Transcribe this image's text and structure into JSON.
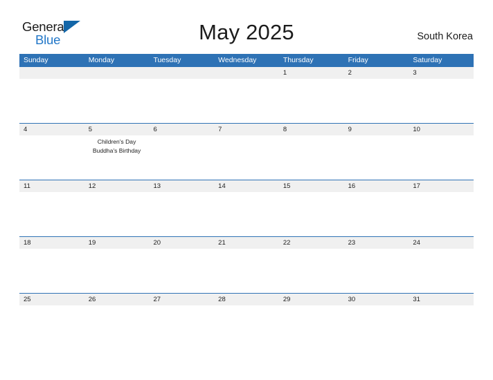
{
  "brand": {
    "name_part1": "General",
    "name_part2": "Blue",
    "colors": {
      "dark": "#1a1a1a",
      "blue": "#2277c8",
      "triangle": "#1366a8"
    }
  },
  "header": {
    "title": "May 2025",
    "country": "South Korea"
  },
  "theme": {
    "header_blue": "#2e72b5",
    "date_band_gray": "#f0f0f0",
    "text": "#1c1c1c",
    "header_text": "#ffffff",
    "background": "#ffffff"
  },
  "calendar": {
    "day_headers": [
      "Sunday",
      "Monday",
      "Tuesday",
      "Wednesday",
      "Thursday",
      "Friday",
      "Saturday"
    ],
    "weeks": [
      {
        "days": [
          {
            "date": "",
            "events": []
          },
          {
            "date": "",
            "events": []
          },
          {
            "date": "",
            "events": []
          },
          {
            "date": "",
            "events": []
          },
          {
            "date": "1",
            "events": []
          },
          {
            "date": "2",
            "events": []
          },
          {
            "date": "3",
            "events": []
          }
        ]
      },
      {
        "days": [
          {
            "date": "4",
            "events": []
          },
          {
            "date": "5",
            "events": [
              "Children's Day",
              "Buddha's Birthday"
            ]
          },
          {
            "date": "6",
            "events": []
          },
          {
            "date": "7",
            "events": []
          },
          {
            "date": "8",
            "events": []
          },
          {
            "date": "9",
            "events": []
          },
          {
            "date": "10",
            "events": []
          }
        ]
      },
      {
        "days": [
          {
            "date": "11",
            "events": []
          },
          {
            "date": "12",
            "events": []
          },
          {
            "date": "13",
            "events": []
          },
          {
            "date": "14",
            "events": []
          },
          {
            "date": "15",
            "events": []
          },
          {
            "date": "16",
            "events": []
          },
          {
            "date": "17",
            "events": []
          }
        ]
      },
      {
        "days": [
          {
            "date": "18",
            "events": []
          },
          {
            "date": "19",
            "events": []
          },
          {
            "date": "20",
            "events": []
          },
          {
            "date": "21",
            "events": []
          },
          {
            "date": "22",
            "events": []
          },
          {
            "date": "23",
            "events": []
          },
          {
            "date": "24",
            "events": []
          }
        ]
      },
      {
        "days": [
          {
            "date": "25",
            "events": []
          },
          {
            "date": "26",
            "events": []
          },
          {
            "date": "27",
            "events": []
          },
          {
            "date": "28",
            "events": []
          },
          {
            "date": "29",
            "events": []
          },
          {
            "date": "30",
            "events": []
          },
          {
            "date": "31",
            "events": []
          }
        ]
      }
    ]
  }
}
